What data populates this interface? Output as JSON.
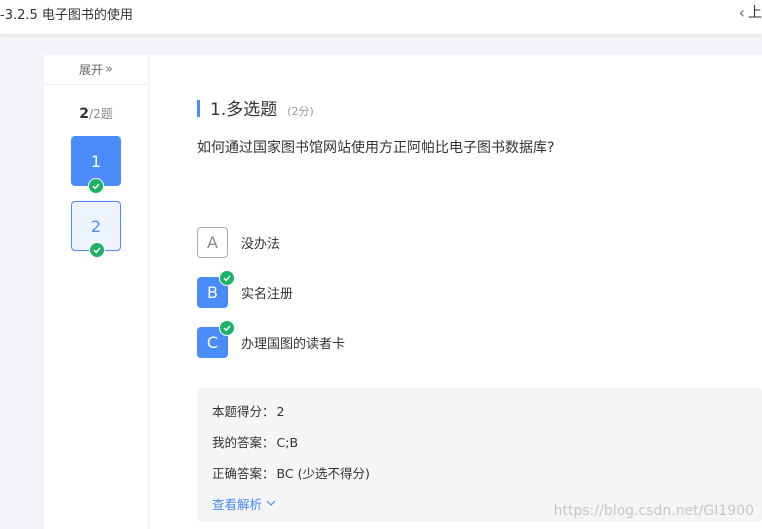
{
  "header": {
    "title": "-3.2.5 电子图书的使用",
    "prev_label": "上"
  },
  "sidebar": {
    "expand_label": "展开",
    "progress_current": "2",
    "progress_total": "/2题",
    "questions": [
      {
        "label": "1",
        "state": "current",
        "answered": true
      },
      {
        "label": "2",
        "state": "normal",
        "answered": true
      }
    ]
  },
  "question": {
    "number_type": "1.多选题",
    "score": "(2分)",
    "text": "如何通过国家图书馆网站使用方正阿帕比电子图书数据库?",
    "options": [
      {
        "letter": "A",
        "text": "没办法",
        "selected": false
      },
      {
        "letter": "B",
        "text": "实名注册",
        "selected": true
      },
      {
        "letter": "C",
        "text": "办理国图的读者卡",
        "selected": true
      }
    ]
  },
  "answer": {
    "score_label": "本题得分：",
    "score_value": "2",
    "my_label": "我的答案：",
    "my_value": "C;B",
    "correct_label": "正确答案：",
    "correct_value": "BC (少选不得分)",
    "analysis_label": "查看解析"
  },
  "watermark": "https://blog.csdn.net/GI1900",
  "colors": {
    "accent": "#4a8df8",
    "check": "#1db366",
    "background": "#f2f4f7"
  }
}
